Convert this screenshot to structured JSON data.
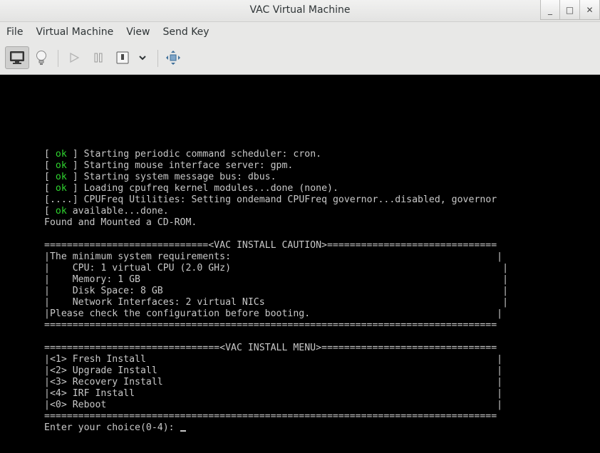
{
  "window": {
    "title": "VAC Virtual Machine",
    "controls": {
      "minimize": "_",
      "maximize": "□",
      "close": "✕"
    }
  },
  "menubar": [
    "File",
    "Virtual Machine",
    "View",
    "Send Key"
  ],
  "toolbar": {
    "icons": [
      "monitor-icon",
      "lightbulb-icon",
      "play-icon",
      "pause-icon",
      "power-icon",
      "chevron-down-icon",
      "fullscreen-icon"
    ]
  },
  "console": {
    "boot_lines": [
      {
        "status": "ok",
        "text": " Starting periodic command scheduler: cron."
      },
      {
        "status": "ok",
        "text": " Starting mouse interface server: gpm."
      },
      {
        "status": "ok",
        "text": " Starting system message bus: dbus."
      },
      {
        "status": "ok",
        "text": " Loading cpufreq kernel modules...done (none)."
      },
      {
        "status": "....",
        "text": " CPUFreq Utilities: Setting ondemand CPUFreq governor...disabled, governor"
      },
      {
        "status": "ok",
        "text": "available...done.",
        "prefix": "[ ",
        "suffix": " "
      }
    ],
    "found_line": "Found and Mounted a CD-ROM.",
    "caution": {
      "header": "=============================<VAC INSTALL CAUTION>==============================",
      "lines": [
        "|The minimum system requirements:                                               |",
        "|    CPU: 1 virtual CPU (2.0 GHz)                                                |",
        "|    Memory: 1 GB                                                                |",
        "|    Disk Space: 8 GB                                                            |",
        "|    Network Interfaces: 2 virtual NICs                                          |",
        "|Please check the configuration before booting.                                 |"
      ],
      "footer": "================================================================================"
    },
    "menu": {
      "header": "===============================<VAC INSTALL MENU>===============================",
      "lines": [
        "|<1> Fresh Install                                                              |",
        "|<2> Upgrade Install                                                            |",
        "|<3> Recovery Install                                                           |",
        "|<4> IRF Install                                                                |",
        "|<0> Reboot                                                                     |"
      ],
      "footer": "================================================================================"
    },
    "prompt": "Enter your choice(0-4): "
  },
  "colors": {
    "ok": "#2fd42f",
    "console_text": "#c8c8c8",
    "console_bg": "#000000"
  }
}
